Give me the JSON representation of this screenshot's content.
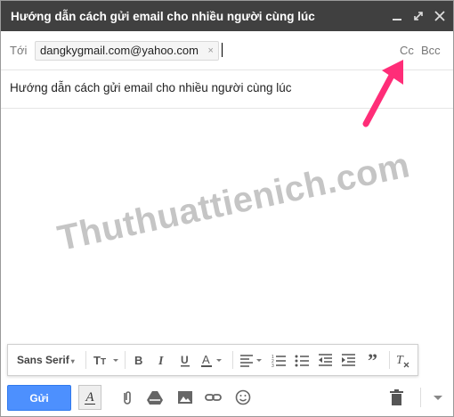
{
  "window": {
    "title": "Hướng dẫn cách gửi email cho nhiều người cùng lúc"
  },
  "recipients": {
    "to_label": "Tới",
    "chip_email": "dangkygmail.com@yahoo.com",
    "chip_remove": "×",
    "cc_label": "Cc",
    "bcc_label": "Bcc"
  },
  "subject": {
    "value": "Hướng dẫn cách gửi email cho nhiều người cùng lúc"
  },
  "body": {
    "watermark": "Thuthuattienich.com"
  },
  "formatting": {
    "font_family": "Sans Serif",
    "font_caret": "▾",
    "icons": [
      "text-size-icon",
      "bold-icon",
      "italic-icon",
      "underline-icon",
      "text-color-icon",
      "align-icon",
      "numbered-list-icon",
      "bulleted-list-icon",
      "indent-less-icon",
      "indent-more-icon",
      "quote-icon",
      "remove-formatting-icon"
    ]
  },
  "bottom": {
    "send_label": "Gửi",
    "icons": [
      "formatting-toggle-icon",
      "attach-icon",
      "drive-icon",
      "photo-icon",
      "link-icon",
      "emoji-icon",
      "trash-icon",
      "more-options-icon"
    ]
  },
  "colors": {
    "titlebar": "#404040",
    "send": "#4d90fe",
    "arrow": "#ff2d78",
    "watermark": "#969696"
  }
}
